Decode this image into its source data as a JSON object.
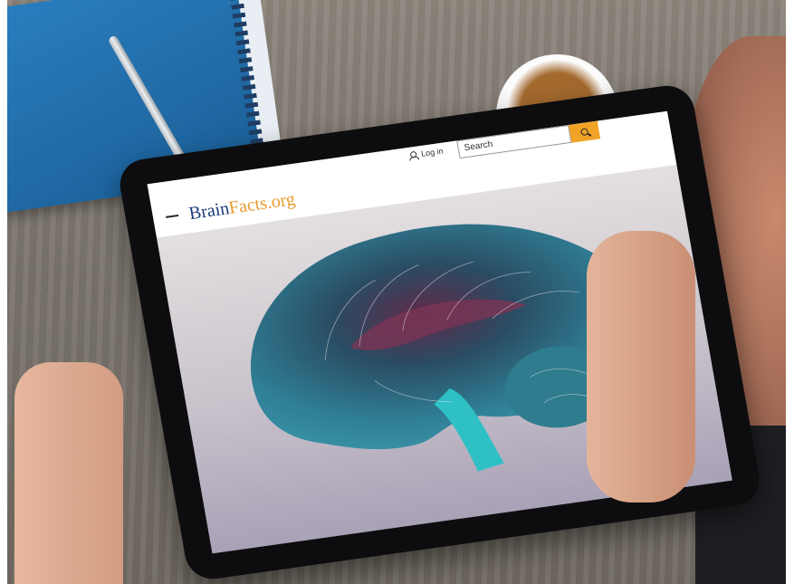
{
  "site": {
    "logo_part1": "Brain",
    "logo_part2": "Facts.org",
    "login_label": "Log in",
    "search_placeholder": "Search"
  },
  "colors": {
    "brand_blue": "#1a3c78",
    "brand_orange": "#e89b2a",
    "search_button": "#f0a327",
    "brain_teal": "#2f7f95"
  },
  "icons": [
    "menu-icon",
    "user-icon",
    "search-icon"
  ]
}
